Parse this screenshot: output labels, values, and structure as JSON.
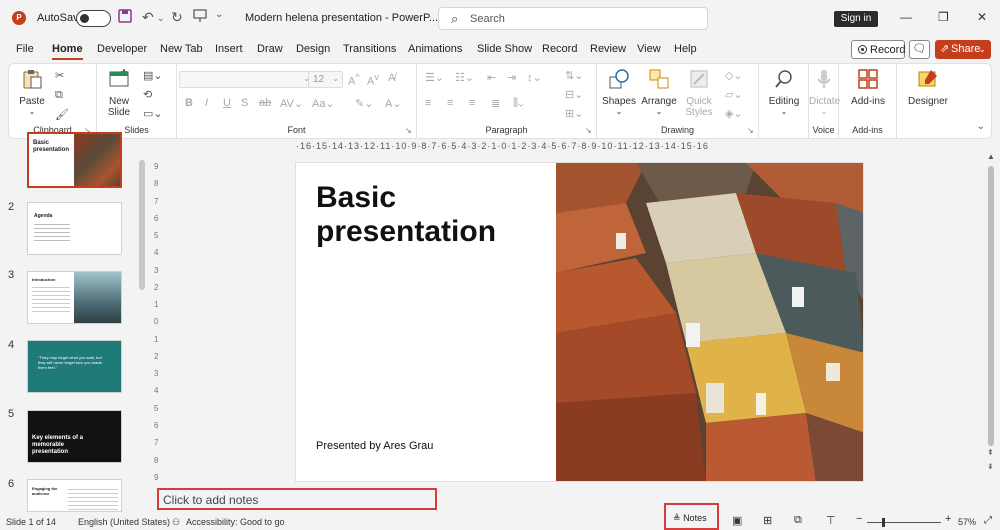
{
  "titlebar": {
    "autosave_label": "AutoSave",
    "doc_title": "Modern helena presentation  -  PowerP...",
    "search_placeholder": "Search",
    "signin_label": "Sign in"
  },
  "tabs": [
    "File",
    "Home",
    "Developer",
    "New Tab",
    "Insert",
    "Draw",
    "Design",
    "Transitions",
    "Animations",
    "Slide Show",
    "Record",
    "Review",
    "View",
    "Help"
  ],
  "active_tab": "Home",
  "actions": {
    "record_label": "Record",
    "share_label": "Share"
  },
  "ribbon": {
    "clipboard": {
      "paste": "Paste",
      "label": "Clipboard"
    },
    "slides": {
      "new_slide_1": "New",
      "new_slide_2": "Slide",
      "label": "Slides"
    },
    "font": {
      "size": "12",
      "label": "Font"
    },
    "paragraph": {
      "label": "Paragraph"
    },
    "drawing": {
      "shapes": "Shapes",
      "arrange": "Arrange",
      "quick_1": "Quick",
      "quick_2": "Styles",
      "label": "Drawing"
    },
    "editing": {
      "label": "Editing"
    },
    "voice": {
      "dictate": "Dictate",
      "label": "Voice"
    },
    "addins": {
      "button": "Add-ins",
      "label": "Add-ins"
    },
    "designer": {
      "label": "Designer"
    }
  },
  "thumbnails": [
    {
      "num": "1",
      "title": "Basic presentation"
    },
    {
      "num": "2",
      "title": "Agenda"
    },
    {
      "num": "3",
      "title": "Introduction"
    },
    {
      "num": "4",
      "title": "\"They may forget what you said, but they will never forget how you made them feel.\""
    },
    {
      "num": "5",
      "title": "Key elements of a memorable presentation"
    },
    {
      "num": "6",
      "title": "Engaging the audience"
    }
  ],
  "ruler_h": "·16·15·14·13·12·11·10·9·8·7·6·5·4·3·2·1·0·1·2·3·4·5·6·7·8·9·10·11·12·13·14·15·16",
  "ruler_v": [
    "9",
    "8",
    "7",
    "6",
    "5",
    "4",
    "3",
    "2",
    "1",
    "0",
    "1",
    "2",
    "3",
    "4",
    "5",
    "6",
    "7",
    "8",
    "9"
  ],
  "slide": {
    "title": "Basic presentation",
    "presenter": "Presented by Ares Grau"
  },
  "notes": {
    "placeholder": "Click to add notes"
  },
  "statusbar": {
    "slide_counter": "Slide 1 of 14",
    "language": "English (United States)",
    "accessibility": "Accessibility: Good to go",
    "notes_label": "Notes",
    "zoom": "57%"
  },
  "colors": {
    "accent": "#c43e1c",
    "highlight_box": "#d83b3b",
    "thumb4_bg": "#1e7b78"
  }
}
